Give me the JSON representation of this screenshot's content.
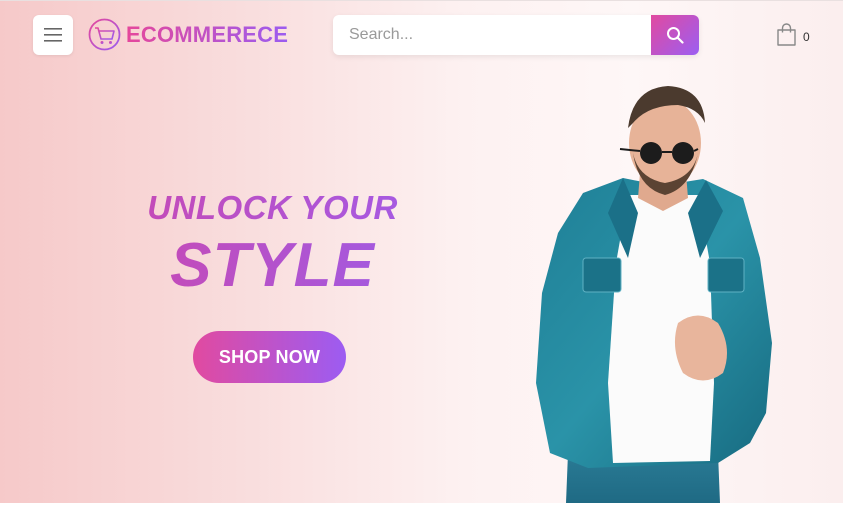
{
  "header": {
    "menu_icon": "hamburger-icon",
    "logo_icon": "shopping-cart-icon",
    "logo_text": "ECOMMERECE",
    "search": {
      "placeholder": "Search...",
      "button_icon": "search-icon"
    },
    "cart": {
      "icon": "shopping-bag-icon",
      "count": "0"
    }
  },
  "hero": {
    "line1": "UNLOCK YOUR",
    "line2": "STYLE",
    "cta_label": "SHOP NOW",
    "image": "man-in-denim-jacket-with-sunglasses"
  },
  "colors": {
    "accent_start": "#e14aa0",
    "accent_end": "#9b5ef2",
    "hero_bg": "#f9dede"
  }
}
